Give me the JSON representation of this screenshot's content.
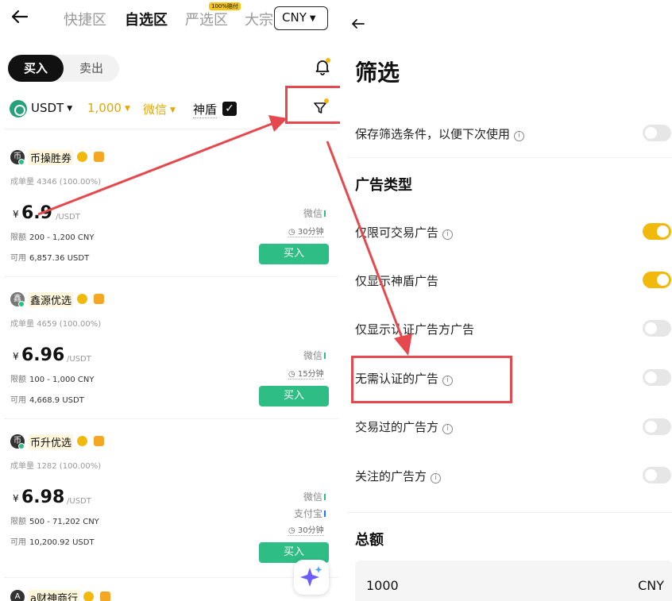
{
  "left": {
    "back_icon": "arrow-left-icon",
    "tabs": [
      "快捷区",
      "自选区",
      "严选区",
      "大宗"
    ],
    "tab_badge": "100%赔付",
    "currency": "CNY",
    "seg_buy": "买入",
    "seg_sell": "卖出",
    "filter": {
      "coin": "USDT",
      "amount": "1,000",
      "payment": "微信",
      "shield": "神盾",
      "shield_checked": true
    },
    "merchants": [
      {
        "avatar": "币",
        "name": "币操胜券",
        "orders": "成单量 4346 (100.00%)",
        "currency_symbol": "¥",
        "price": "6.9",
        "unit": "/USDT",
        "limit_label": "限额",
        "limit": "200 - 1,200 CNY",
        "avail_label": "可用",
        "available": "6,857.36 USDT",
        "payments": [
          "微信"
        ],
        "time": "30分钟",
        "buy": "买入"
      },
      {
        "avatar": "鑫",
        "name": "鑫源优选",
        "orders": "成单量 4659 (100.00%)",
        "currency_symbol": "¥",
        "price": "6.96",
        "unit": "/USDT",
        "limit_label": "限额",
        "limit": "100 - 1,000 CNY",
        "avail_label": "可用",
        "available": "4,668.9 USDT",
        "payments": [
          "微信"
        ],
        "time": "15分钟",
        "buy": "买入"
      },
      {
        "avatar": "币",
        "name": "币升优选",
        "orders": "成单量 1282 (100.00%)",
        "currency_symbol": "¥",
        "price": "6.98",
        "unit": "/USDT",
        "limit_label": "限额",
        "limit": "500 - 71,202 CNY",
        "avail_label": "可用",
        "available": "10,200.92 USDT",
        "payments": [
          "微信",
          "支付宝"
        ],
        "time": "30分钟",
        "buy": "买入"
      },
      {
        "avatar": "A",
        "name": "a财神商行"
      }
    ],
    "colors": {
      "buy_green": "#2ebd85",
      "accent_yellow": "#f0b90b",
      "highlight_red": "#e5484d"
    }
  },
  "right": {
    "back_icon": "arrow-left-icon",
    "title": "筛选",
    "save_filter": "保存筛选条件，以便下次使用",
    "ad_type_title": "广告类型",
    "options": [
      {
        "label": "仅限可交易广告",
        "info": true,
        "on": true
      },
      {
        "label": "仅显示神盾广告",
        "info": false,
        "on": true
      },
      {
        "label": "仅显示认证广告方广告",
        "info": false,
        "on": false
      },
      {
        "label": "无需认证的广告",
        "info": true,
        "on": false
      },
      {
        "label": "交易过的广告方",
        "info": true,
        "on": false
      },
      {
        "label": "关注的广告方",
        "info": true,
        "on": false
      }
    ],
    "amount_title": "总额",
    "amount_value": "1000",
    "amount_currency": "CNY"
  }
}
